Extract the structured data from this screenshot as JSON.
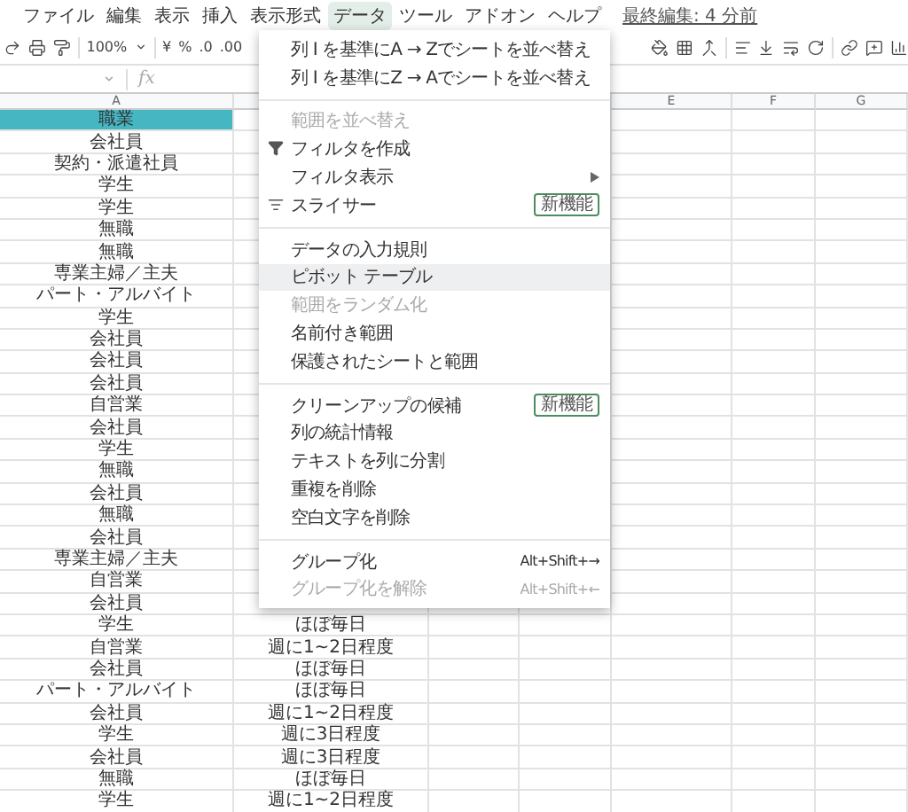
{
  "menubar": {
    "items": [
      {
        "label": "ファイル",
        "selected": false
      },
      {
        "label": "編集",
        "selected": false
      },
      {
        "label": "表示",
        "selected": false
      },
      {
        "label": "挿入",
        "selected": false
      },
      {
        "label": "表示形式",
        "selected": false
      },
      {
        "label": "データ",
        "selected": true
      },
      {
        "label": "ツール",
        "selected": false
      },
      {
        "label": "アドオン",
        "selected": false
      },
      {
        "label": "ヘルプ",
        "selected": false
      }
    ],
    "last_edit": "最終編集: 4 分前"
  },
  "toolbar": {
    "zoom": "100%",
    "currency": "¥",
    "percent": "%",
    "decimal_less": ".0",
    "decimal_more": ".00"
  },
  "formula_bar": {
    "fx": "fx"
  },
  "columns": [
    {
      "label": "A"
    },
    {},
    {},
    {},
    {
      "label": "E"
    },
    {
      "label": "F"
    },
    {
      "label": "G"
    }
  ],
  "rows": [
    {
      "a": "職業",
      "header": true
    },
    {
      "a": "会社員"
    },
    {
      "a": "契約・派遣社員"
    },
    {
      "a": "学生"
    },
    {
      "a": "学生"
    },
    {
      "a": "無職"
    },
    {
      "a": "無職"
    },
    {
      "a": "専業主婦／主夫"
    },
    {
      "a": "パート・アルバイト"
    },
    {
      "a": "学生"
    },
    {
      "a": "会社員"
    },
    {
      "a": "会社員"
    },
    {
      "a": "会社員"
    },
    {
      "a": "自営業"
    },
    {
      "a": "会社員"
    },
    {
      "a": "学生"
    },
    {
      "a": "無職"
    },
    {
      "a": "会社員"
    },
    {
      "a": "無職"
    },
    {
      "a": "会社員"
    },
    {
      "a": "専業主婦／主夫"
    },
    {
      "a": "自営業"
    },
    {
      "a": "会社員"
    },
    {
      "a": "学生",
      "b": "ほぼ毎日"
    },
    {
      "a": "自営業",
      "b": "週に1~2日程度"
    },
    {
      "a": "会社員",
      "b": "ほぼ毎日"
    },
    {
      "a": "パート・アルバイト",
      "b": "ほぼ毎日"
    },
    {
      "a": "会社員",
      "b": "週に1~2日程度"
    },
    {
      "a": "学生",
      "b": "週に3日程度"
    },
    {
      "a": "会社員",
      "b": "週に3日程度"
    },
    {
      "a": "無職",
      "b": "ほぼ毎日"
    },
    {
      "a": "学生",
      "b": "週に1~2日程度"
    }
  ],
  "data_menu": {
    "sections": [
      [
        {
          "kind": "plain",
          "label": "列 I を基準にA → Zでシートを並べ替え",
          "disabled": false,
          "highlighted": false
        },
        {
          "kind": "plain",
          "label": "列 I を基準にZ → Aでシートを並べ替え",
          "disabled": false,
          "highlighted": false
        }
      ],
      [
        {
          "kind": "plain",
          "label": "範囲を並べ替え",
          "disabled": true,
          "highlighted": false
        },
        {
          "kind": "filter",
          "label": "フィルタを作成",
          "disabled": false,
          "highlighted": false
        },
        {
          "kind": "plain",
          "label": "フィルタ表示",
          "disabled": false,
          "highlighted": false,
          "submenu": true
        },
        {
          "kind": "slicer",
          "label": "スライサー",
          "disabled": false,
          "highlighted": false,
          "badge": "新機能"
        }
      ],
      [
        {
          "kind": "plain",
          "label": "データの入力規則",
          "disabled": false,
          "highlighted": false
        },
        {
          "kind": "plain",
          "label": "ピボット テーブル",
          "disabled": false,
          "highlighted": true
        },
        {
          "kind": "plain",
          "label": "範囲をランダム化",
          "disabled": true,
          "highlighted": false
        },
        {
          "kind": "plain",
          "label": "名前付き範囲",
          "disabled": false,
          "highlighted": false
        },
        {
          "kind": "plain",
          "label": "保護されたシートと範囲",
          "disabled": false,
          "highlighted": false
        }
      ],
      [
        {
          "kind": "plain",
          "label": "クリーンアップの候補",
          "disabled": false,
          "highlighted": false,
          "badge": "新機能"
        },
        {
          "kind": "plain",
          "label": "列の統計情報",
          "disabled": false,
          "highlighted": false
        },
        {
          "kind": "plain",
          "label": "テキストを列に分割",
          "disabled": false,
          "highlighted": false
        },
        {
          "kind": "plain",
          "label": "重複を削除",
          "disabled": false,
          "highlighted": false
        },
        {
          "kind": "plain",
          "label": "空白文字を削除",
          "disabled": false,
          "highlighted": false
        }
      ],
      [
        {
          "kind": "plain",
          "label": "グループ化",
          "disabled": false,
          "highlighted": false,
          "shortcut": "Alt+Shift+→"
        },
        {
          "kind": "plain",
          "label": "グループ化を解除",
          "disabled": true,
          "highlighted": false,
          "shortcut": "Alt+Shift+←"
        }
      ]
    ]
  }
}
